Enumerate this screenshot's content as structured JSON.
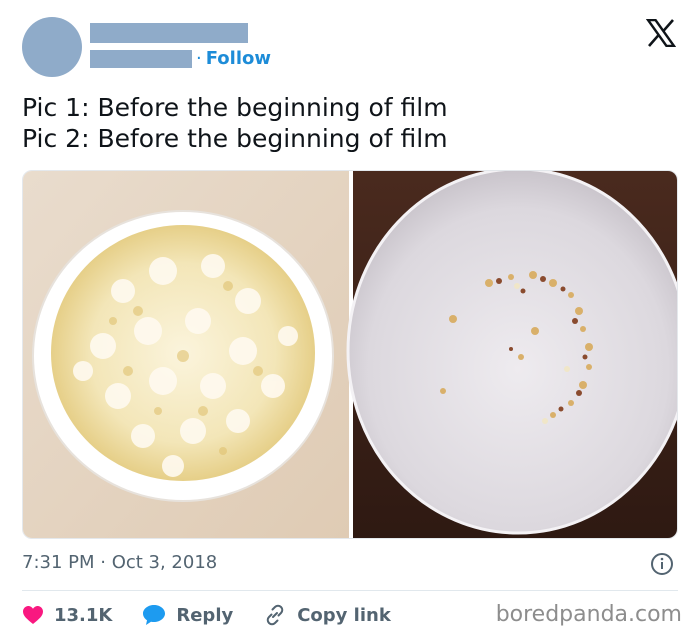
{
  "header": {
    "follow_separator": "·",
    "follow_label": "Follow"
  },
  "tweet": {
    "lines": [
      "Pic 1: Before the beginning of film",
      "Pic 2: Before the beginning of film"
    ],
    "time": "7:31 PM · Oct 3, 2018"
  },
  "actions": {
    "likes": "13.1K",
    "reply_label": "Reply",
    "copy_link_label": "Copy link"
  },
  "watermark": "boredpanda.com",
  "icons": {
    "brand": "x-logo-icon",
    "info": "info-icon",
    "like": "heart-icon",
    "reply": "speech-bubble-icon",
    "copy": "link-icon"
  },
  "colors": {
    "accent": "#1d8cd8",
    "heart": "#f91880",
    "placeholder": "#8fabc9",
    "muted": "#536471"
  }
}
